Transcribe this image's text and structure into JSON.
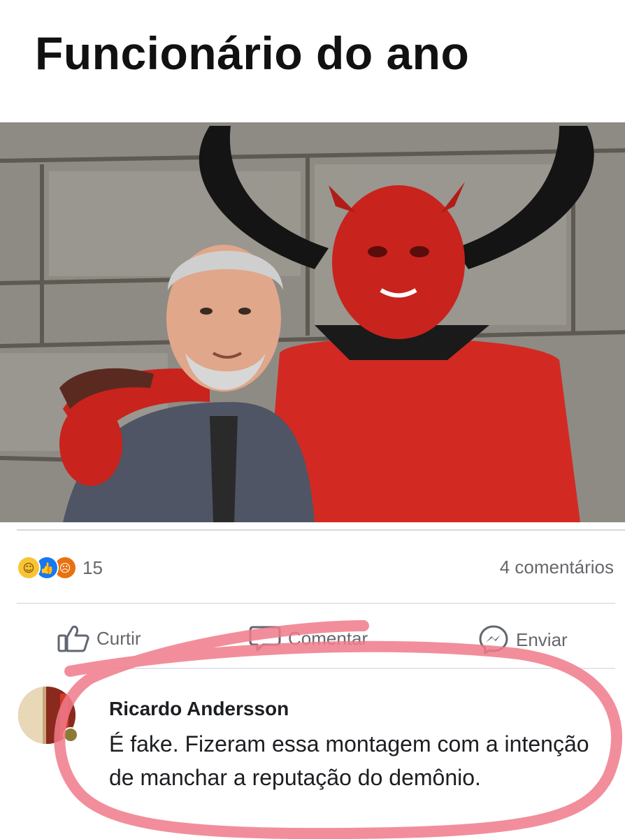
{
  "post": {
    "title": "Funcionário do ano"
  },
  "photo": {
    "description_icon": "meme-photo"
  },
  "reactions": {
    "icons": [
      "haha-reaction-icon",
      "like-reaction-icon",
      "angry-reaction-icon"
    ],
    "count": "15"
  },
  "comments_count": "4 comentários",
  "actions": {
    "like_label": "Curtir",
    "comment_label": "Comentar",
    "send_label": "Enviar"
  },
  "comment": {
    "author": "Ricardo Andersson",
    "text": "É fake. Fizeram essa montagem com a intenção de manchar a reputação do demônio."
  },
  "colors": {
    "highlight": "#f07a8a",
    "facebook_blue": "#1877f2",
    "muted_text": "#65676b"
  }
}
